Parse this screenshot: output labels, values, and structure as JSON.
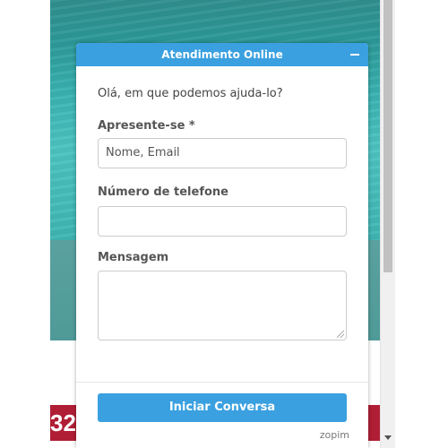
{
  "background_page": {
    "banner_number": "32",
    "colors": {
      "sea": "#3ab3b2",
      "banner": "#b01e35"
    }
  },
  "widget": {
    "title": "Atendimento Online",
    "minimize_icon": "minus-icon",
    "greeting": "Olá, em que podemos ajuda-lo?",
    "fields": {
      "name_label": "Apresente-se *",
      "name_placeholder": "Nome, Email",
      "phone_label": "Número de telefone",
      "phone_value": "",
      "message_label": "Mensagem",
      "message_value": ""
    },
    "start_button_label": "Iniciar Conversa",
    "brand": "zopim",
    "accent_color": "#3aa0e0"
  }
}
